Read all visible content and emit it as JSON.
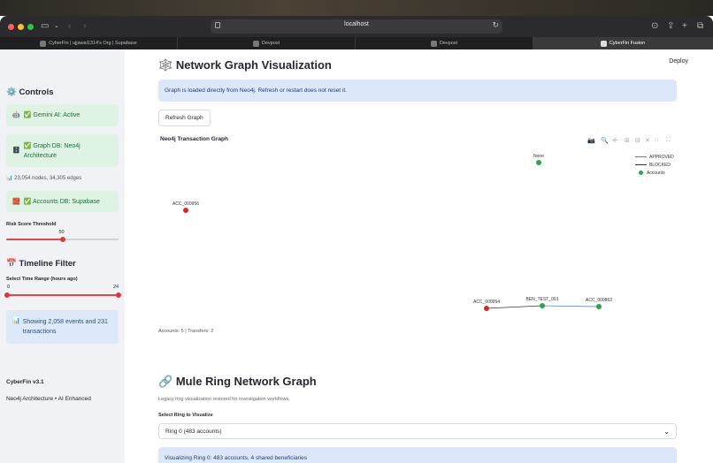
{
  "browser": {
    "url": "localhost",
    "tabs": [
      {
        "label": "CyberFin | ujjawal1314's Org | Supabase",
        "active": false
      },
      {
        "label": "Devpost",
        "active": false
      },
      {
        "label": "Devpost",
        "active": false
      },
      {
        "label": "CyberFin Fusion",
        "active": true
      }
    ]
  },
  "sidebar": {
    "controls_title": "Controls",
    "gemini_status": "✅ Gemini AI: Active",
    "graph_db_status": "✅ Graph DB: Neo4j Architecture",
    "graph_stats": "23,054 nodes, 34,305 edges",
    "accounts_db_status": "✅ Accounts DB: Supabase",
    "risk_label": "Risk Score Threshold",
    "risk_value": "50",
    "risk_fraction": 0.5,
    "timeline_title": "Timeline Filter",
    "time_range_label": "Select Time Range (hours ago)",
    "time_min": "0",
    "time_max": "24",
    "showing_text": "Showing 2,058 events and 231 transactions",
    "version": "CyberFin v3.1",
    "tagline": "Neo4j Architecture • AI Enhanced"
  },
  "main": {
    "deploy_label": "Deploy",
    "title": "Network Graph Visualization",
    "info_text": "Graph is loaded directly from Neo4j. Refresh or restart does not reset it.",
    "refresh_label": "Refresh Graph",
    "chart_stats": "Accounts: 5 | Transfers: 2",
    "mule_title": "Mule Ring Network Graph",
    "mule_caption": "Legacy ring visualization restored for investigation workflows.",
    "select_label": "Select Ring to Visualize",
    "select_value": "Ring 0 (483 accounts)",
    "ring_info": "Visualizing Ring 0: 483 accounts, 4 shared beneficiaries"
  },
  "chart_data": {
    "type": "network",
    "title": "Neo4j Transaction Graph",
    "legend": [
      {
        "label": "APPROVED",
        "kind": "line",
        "color": "#4a7fc1"
      },
      {
        "label": "BLOCKED",
        "kind": "line",
        "color": "#333333"
      },
      {
        "label": "Accounts",
        "kind": "dot",
        "color": "#2ca24c"
      }
    ],
    "nodes": [
      {
        "id": "None",
        "color": "#2ca24c"
      },
      {
        "id": "ACC_000956",
        "color": "#d62728"
      },
      {
        "id": "ACC_000954",
        "color": "#d62728"
      },
      {
        "id": "BEN_TEST_001",
        "color": "#2ca24c"
      },
      {
        "id": "ACC_000863",
        "color": "#2ca24c"
      }
    ],
    "edges": [
      {
        "source": "ACC_000954",
        "target": "BEN_TEST_001",
        "status": "BLOCKED",
        "color": "#333333"
      },
      {
        "source": "BEN_TEST_001",
        "target": "ACC_000863",
        "status": "APPROVED",
        "color": "#4a7fc1"
      }
    ]
  }
}
